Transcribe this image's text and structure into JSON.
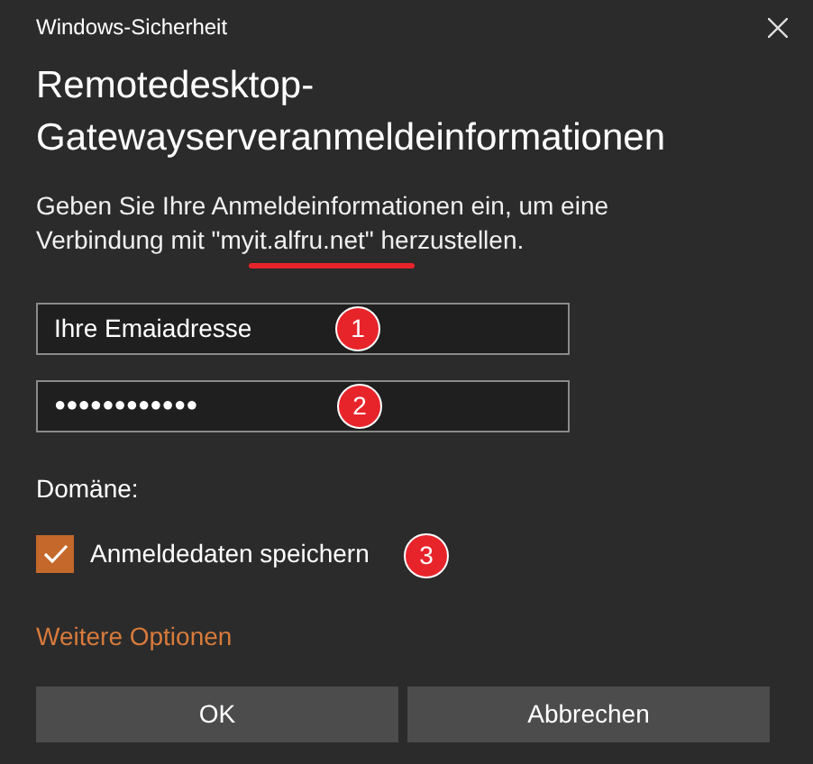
{
  "window": {
    "title": "Windows-Sicherheit"
  },
  "heading": "Remotedesktop-Gatewayserveranmeldeinformationen",
  "description": "Geben Sie Ihre Anmeldeinformationen ein, um eine Verbindung mit \"myit.alfru.net\" herzustellen.",
  "fields": [
    {
      "kind": "text",
      "value": "Ihre Emaiadresse",
      "badge": "1"
    },
    {
      "kind": "password",
      "value": "●●●●●●●●●●●●",
      "badge": "2"
    }
  ],
  "domain_label": "Domäne:",
  "remember": {
    "label": "Anmeldedaten speichern",
    "checked": true,
    "badge": "3"
  },
  "more_options": "Weitere Optionen",
  "buttons": [
    "OK",
    "Abbrechen"
  ]
}
